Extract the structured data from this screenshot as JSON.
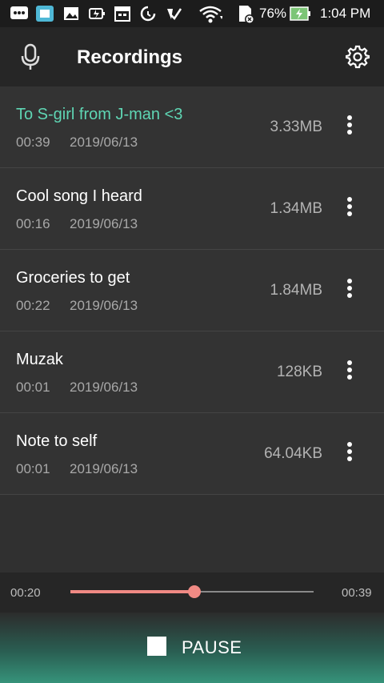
{
  "status_bar": {
    "battery": "76%",
    "time": "1:04 PM",
    "icons": [
      "messages-icon",
      "app-icon",
      "gallery-icon",
      "battery-saver-icon",
      "calendar-icon",
      "sync-icon",
      "check-icon",
      "wifi-icon",
      "no-sim-icon",
      "battery-charging-icon"
    ]
  },
  "app_bar": {
    "title": "Recordings",
    "left_icon": "microphone-icon",
    "right_icon": "settings-gear-icon"
  },
  "recordings": [
    {
      "title": "To S-girl from J-man <3",
      "duration": "00:39",
      "date": "2019/06/13",
      "size": "3.33MB",
      "active": true
    },
    {
      "title": "Cool song I heard",
      "duration": "00:16",
      "date": "2019/06/13",
      "size": "1.34MB",
      "active": false
    },
    {
      "title": "Groceries to get",
      "duration": "00:22",
      "date": "2019/06/13",
      "size": "1.84MB",
      "active": false
    },
    {
      "title": "Muzak",
      "duration": "00:01",
      "date": "2019/06/13",
      "size": "128KB",
      "active": false
    },
    {
      "title": "Note to self",
      "duration": "00:01",
      "date": "2019/06/13",
      "size": "64.04KB",
      "active": false
    }
  ],
  "player": {
    "elapsed": "00:20",
    "total": "00:39",
    "progress": 0.51
  },
  "controls": {
    "pause_label": "PAUSE"
  },
  "colors": {
    "accent_active_title": "#5fd6b4",
    "seek_accent": "#f08a84",
    "pause_bar_gradient_end": "#36937a",
    "background": "#303030"
  }
}
